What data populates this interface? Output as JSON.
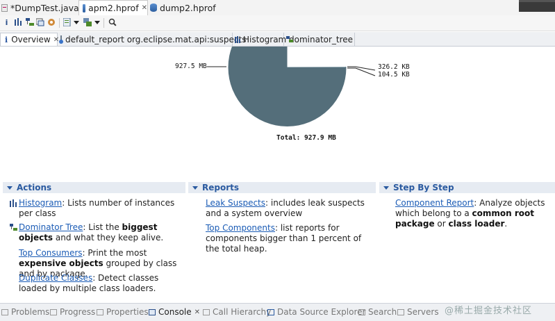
{
  "editor_tabs": [
    {
      "label": "*DumpTest.java",
      "icon": "java-file-icon"
    },
    {
      "label": "apm2.hprof",
      "icon": "heap-dump-icon",
      "active": true
    },
    {
      "label": "dump2.hprof",
      "icon": "heap-dump-icon"
    }
  ],
  "view_tabs": [
    {
      "label": "Overview",
      "icon": "info-icon",
      "active": true
    },
    {
      "label": "default_report  org.eclipse.mat.api:suspects",
      "icon": "report-icon"
    },
    {
      "label": "Histogram",
      "icon": "histogram-icon"
    },
    {
      "label": "dominator_tree",
      "icon": "dominator-tree-icon"
    }
  ],
  "pie": {
    "label_left": "927.5 MB",
    "label_right_1": "326.2 KB",
    "label_right_2": "104.5 KB",
    "total": "Total: 927.9 MB",
    "color": "#546e7a"
  },
  "chart_data": {
    "type": "pie",
    "values_mb": [
      927.5,
      0.3262,
      0.1045
    ],
    "labels": [
      "927.5 MB",
      "326.2 KB",
      "104.5 KB"
    ],
    "total": "Total: 927.9 MB"
  },
  "sections": {
    "actions": {
      "title": "Actions",
      "histogram_link": "Histogram",
      "histogram_text": ": Lists number of instances per class",
      "dominator_link": "Dominator Tree",
      "dominator_text_1": ": List the ",
      "dominator_bold": "biggest objects",
      "dominator_text_2": " and what they keep alive.",
      "consumers_link": "Top Consumers",
      "consumers_text_1": ": Print the most ",
      "consumers_bold": "expensive objects",
      "consumers_text_2": " grouped by class and by package.",
      "duplicate_link": "Duplicate Classes",
      "duplicate_text": ": Detect classes loaded by multiple class loaders."
    },
    "reports": {
      "title": "Reports",
      "leak_link": "Leak Suspects",
      "leak_text": ": includes leak suspects and a system overview",
      "top_link": "Top Components",
      "top_text": ": list reports for components bigger than 1 percent of the total heap."
    },
    "step": {
      "title": "Step By Step",
      "component_link": "Component Report",
      "component_text_1": ": Analyze objects which belong to a ",
      "component_bold_1": "common root package",
      "component_text_2": " or ",
      "component_bold_2": "class loader",
      "component_text_3": "."
    }
  },
  "bottom_tabs": [
    {
      "label": "Problems",
      "icon": "problems-icon"
    },
    {
      "label": "Progress",
      "icon": "progress-icon"
    },
    {
      "label": "Properties",
      "icon": "properties-icon"
    },
    {
      "label": "Console",
      "icon": "console-icon",
      "active": true
    },
    {
      "label": "Call Hierarchy",
      "icon": "call-hierarchy-icon"
    },
    {
      "label": "Data Source Explorer",
      "icon": "data-source-icon"
    },
    {
      "label": "Search",
      "icon": "search-icon"
    },
    {
      "label": "Servers",
      "icon": "servers-icon"
    }
  ],
  "watermark": "@稀土掘金技术社区"
}
